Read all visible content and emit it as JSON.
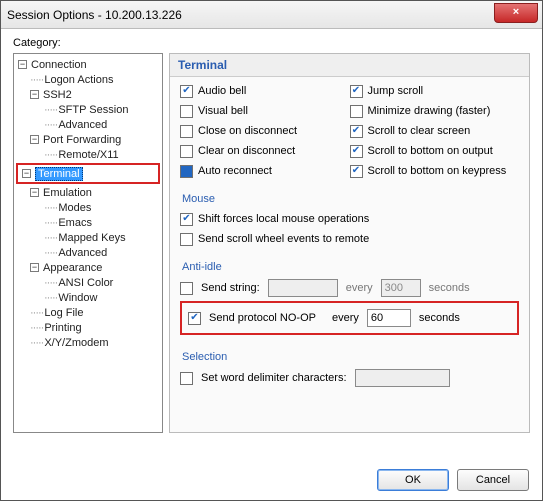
{
  "window": {
    "title": "Session Options - 10.200.13.226",
    "close_glyph": "×"
  },
  "category_label": "Category:",
  "tree": {
    "items": [
      "Connection",
      "Logon Actions",
      "SSH2",
      "SFTP Session",
      "Advanced",
      "Port Forwarding",
      "Remote/X11",
      "Terminal",
      "Emulation",
      "Modes",
      "Emacs",
      "Mapped Keys",
      "Advanced",
      "Appearance",
      "ANSI Color",
      "Window",
      "Log File",
      "Printing",
      "X/Y/Zmodem"
    ]
  },
  "panel": {
    "header": "Terminal",
    "left_checks": [
      {
        "label": "Audio bell",
        "checked": true
      },
      {
        "label": "Visual bell",
        "checked": false
      },
      {
        "label": "Close on disconnect",
        "checked": false
      },
      {
        "label": "Clear on disconnect",
        "checked": false
      },
      {
        "label": "Auto reconnect",
        "checked": false,
        "filled": true
      }
    ],
    "right_checks": [
      {
        "label": "Jump scroll",
        "checked": true
      },
      {
        "label": "Minimize drawing (faster)",
        "checked": false
      },
      {
        "label": "Scroll to clear screen",
        "checked": true
      },
      {
        "label": "Scroll to bottom on output",
        "checked": true
      },
      {
        "label": "Scroll to bottom on keypress",
        "checked": true
      }
    ],
    "mouse": {
      "label": "Mouse",
      "shift_forces": {
        "label": "Shift forces local mouse operations",
        "checked": true
      },
      "send_wheel": {
        "label": "Send scroll wheel events to remote",
        "checked": false
      }
    },
    "anti_idle": {
      "label": "Anti-idle",
      "send_string": {
        "label": "Send string:",
        "checked": false,
        "value": "",
        "every": "every",
        "interval": "300",
        "unit": "seconds"
      },
      "send_noop": {
        "label": "Send protocol NO-OP",
        "checked": true,
        "every": "every",
        "interval": "60",
        "unit": "seconds"
      }
    },
    "selection": {
      "label": "Selection",
      "word_delim": {
        "label": "Set word delimiter characters:",
        "checked": false,
        "value": ""
      }
    }
  },
  "buttons": {
    "ok": "OK",
    "cancel": "Cancel"
  }
}
